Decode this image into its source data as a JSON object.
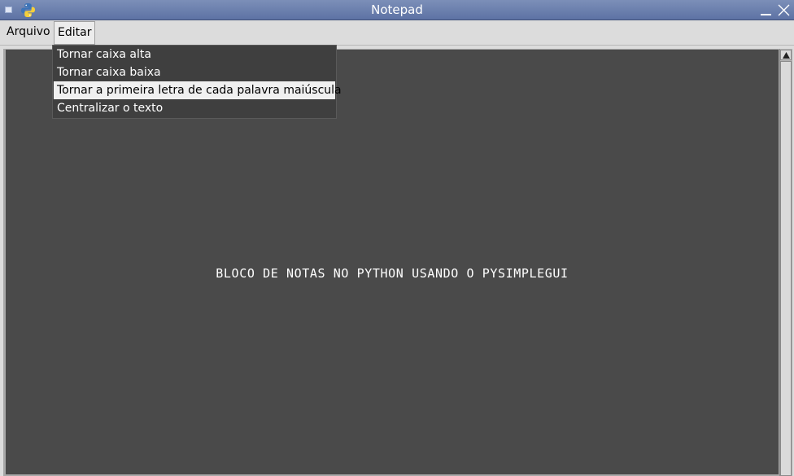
{
  "window": {
    "title": "Notepad"
  },
  "menubar": {
    "items": [
      {
        "label": "Arquivo"
      },
      {
        "label": "Editar"
      }
    ]
  },
  "edit_menu": {
    "items": [
      {
        "label": "Tornar caixa alta",
        "highlighted": false
      },
      {
        "label": "Tornar caixa baixa",
        "highlighted": false
      },
      {
        "label": "Tornar a primeira letra de cada palavra maiúscula",
        "highlighted": true
      },
      {
        "label": "Centralizar o texto",
        "highlighted": false
      }
    ]
  },
  "editor": {
    "content": "BLOCO DE NOTAS NO PYTHON USANDO O PYSIMPLEGUI",
    "background_color": "#4a4a4a",
    "text_color": "#ffffff"
  },
  "icons": {
    "app": "python-logo-icon",
    "window_menu": "window-menu-icon",
    "minimize": "minimize-icon",
    "close": "close-icon",
    "scroll_up": "arrow-up-icon"
  }
}
